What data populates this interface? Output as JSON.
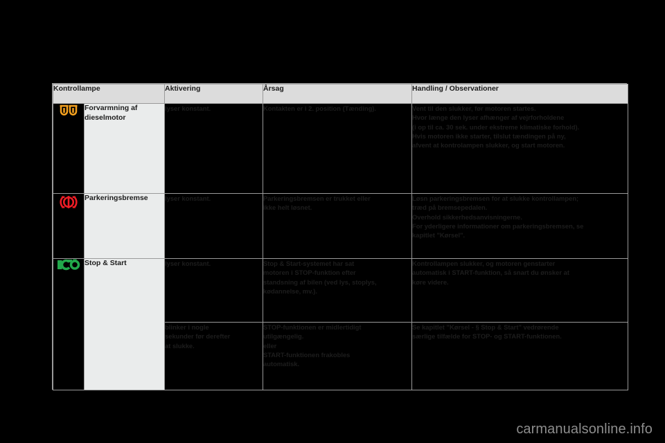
{
  "page": {
    "background_color": "#000000",
    "watermark": "carmanualsonline.info"
  },
  "table": {
    "headers": {
      "lamp": "Kontrollampe",
      "activation": "Aktivering",
      "cause": "Årsag",
      "action": "Handling / Observationer"
    },
    "rows": [
      {
        "icon_name": "diesel-preheat-icon",
        "icon_color": "#F5A11E",
        "name": "Forvarmning af dieselmotor",
        "activation": [
          "lyser konstant."
        ],
        "cause": [
          "Kontakten er i 2. position (Tænding)."
        ],
        "action": [
          "Vent til den slukker, før motoren startes.",
          "Hvor længe den lyser afhænger af vejrforholdene",
          "(i op til ca. 30 sek. under ekstreme klimatiske forhold).",
          "Hvis motoren ikke starter, tilslut tændingen på ny,",
          "afvent at kontrolampen slukker, og start motoren."
        ]
      },
      {
        "icon_name": "parking-brake-icon",
        "icon_color": "#EE1C25",
        "name": "Parkeringsbremse",
        "activation": [
          "lyser konstant."
        ],
        "cause": [
          "Parkeringsbremsen er trukket eller",
          "ikke helt løsnet."
        ],
        "action": [
          "Løsn parkeringsbremsen for at slukke kontrollampen;",
          "træd på bremsepedalen.",
          "Overhold sikkerhedsanvisningerne.",
          "For yderligere informationer om parkeringsbremsen, se",
          "kapitlet \"Kørsel\"."
        ]
      },
      {
        "icon_name": "eco-stop-start-icon",
        "icon_color": "#22A84B",
        "name": "Stop & Start",
        "sub_rows": [
          {
            "activation": [
              "lyser konstant."
            ],
            "cause": [
              "Stop & Start-systemet har sat",
              "motoren i STOP-funktion efter",
              "standsning af bilen (ved lys, stoplys,",
              "kødannelse, mv.)."
            ],
            "action": [
              "Kontrollampen slukker, og motoren genstarter",
              "automatisk i START-funktion, så snart du ønsker at",
              "køre videre."
            ]
          },
          {
            "activation": [
              "blinker i nogle",
              "sekunder før derefter",
              "at slukke."
            ],
            "cause": [
              "STOP-funktionen er midlertidigt",
              "utilgængelig.",
              "eller",
              "START-funktionen frakobles",
              "automatisk."
            ],
            "action": [
              "Se kapitlet \"Kørsel - § Stop & Start\" vedrørende",
              "særlige tilfælde for STOP- og START-funktionen."
            ]
          }
        ]
      }
    ]
  }
}
